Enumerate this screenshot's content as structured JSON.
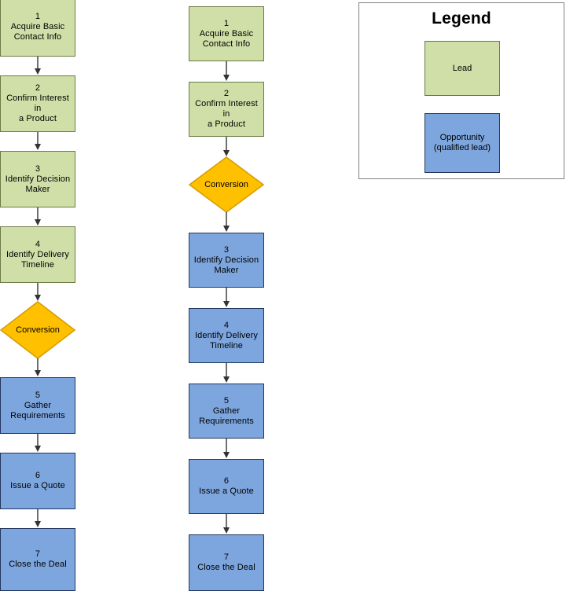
{
  "diagram": {
    "title_hidden": "Sales Lead to Opportunity Conversion Flow",
    "columns": [
      {
        "name": "before-conversion-flow",
        "nodes": [
          {
            "id": "l1",
            "type": "process",
            "category": "lead",
            "label": "1\nAcquire Basic\nContact Info"
          },
          {
            "id": "l2",
            "type": "process",
            "category": "lead",
            "label": "2\nConfirm Interest in\na Product"
          },
          {
            "id": "l3",
            "type": "process",
            "category": "lead",
            "label": "3\nIdentify Decision\nMaker"
          },
          {
            "id": "l4",
            "type": "process",
            "category": "lead",
            "label": "4\nIdentify Delivery\nTimeline"
          },
          {
            "id": "l5",
            "type": "decision",
            "category": "conversion",
            "label": "Conversion"
          },
          {
            "id": "l6",
            "type": "process",
            "category": "opportunity",
            "label": "5\nGather\nRequirements"
          },
          {
            "id": "l7",
            "type": "process",
            "category": "opportunity",
            "label": "6\nIssue a Quote"
          },
          {
            "id": "l8",
            "type": "process",
            "category": "opportunity",
            "label": "7\nClose the Deal"
          }
        ]
      },
      {
        "name": "early-conversion-flow",
        "nodes": [
          {
            "id": "m1",
            "type": "process",
            "category": "lead",
            "label": "1\nAcquire Basic\nContact Info"
          },
          {
            "id": "m2",
            "type": "process",
            "category": "lead",
            "label": "2\nConfirm Interest in\na Product"
          },
          {
            "id": "m3",
            "type": "decision",
            "category": "conversion",
            "label": "Conversion"
          },
          {
            "id": "m4",
            "type": "process",
            "category": "opportunity",
            "label": "3\nIdentify Decision\nMaker"
          },
          {
            "id": "m5",
            "type": "process",
            "category": "opportunity",
            "label": "4\nIdentify Delivery\nTimeline"
          },
          {
            "id": "m6",
            "type": "process",
            "category": "opportunity",
            "label": "5\nGather\nRequirements"
          },
          {
            "id": "m7",
            "type": "process",
            "category": "opportunity",
            "label": "6\nIssue a Quote"
          },
          {
            "id": "m8",
            "type": "process",
            "category": "opportunity",
            "label": "7\nClose the Deal"
          }
        ]
      }
    ]
  },
  "legend": {
    "title": "Legend",
    "items": [
      {
        "id": "legend-lead",
        "label": "Lead",
        "category": "lead"
      },
      {
        "id": "legend-opportunity",
        "label": "Opportunity\n(qualified lead)",
        "category": "opportunity"
      }
    ]
  },
  "colors": {
    "lead_fill": "#cfdfa7",
    "lead_stroke": "#6b7a47",
    "opportunity_fill": "#7ea6de",
    "opportunity_stroke": "#22365e",
    "conversion_fill": "#ffc000",
    "conversion_stroke": "#d79b00",
    "connector": "#333333",
    "legend_border": "#808080",
    "background": "#ffffff"
  }
}
